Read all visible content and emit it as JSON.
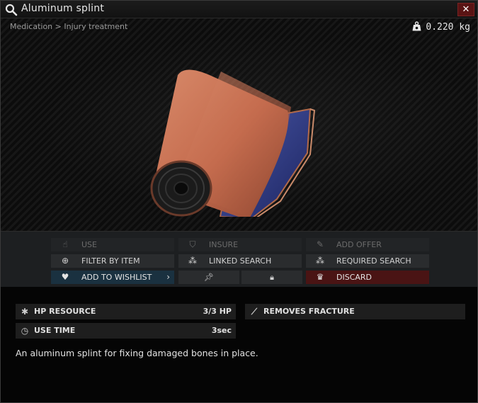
{
  "window": {
    "title": "Aluminum splint",
    "close": "✕"
  },
  "header": {
    "breadcrumb": "Medication > Injury treatment",
    "weight": "0.220 kg"
  },
  "actions": {
    "use": "USE",
    "insure": "INSURE",
    "add_offer": "ADD OFFER",
    "filter_by_item": "FILTER BY ITEM",
    "linked_search": "LINKED SEARCH",
    "required_search": "REQUIRED SEARCH",
    "add_to_wishlist": "ADD TO WISHLIST",
    "discard": "DISCARD"
  },
  "stats": [
    {
      "label": "HP RESOURCE",
      "value": "3/3 HP"
    },
    {
      "label": "USE TIME",
      "value": "3sec"
    },
    {
      "label": "REMOVES FRACTURE",
      "value": ""
    }
  ],
  "description": "An aluminum splint for fixing damaged bones in place.",
  "colors": {
    "discard_bg": "#4a1414",
    "wishlist_bg": "#1a3140",
    "close_bg": "#5a1414"
  }
}
